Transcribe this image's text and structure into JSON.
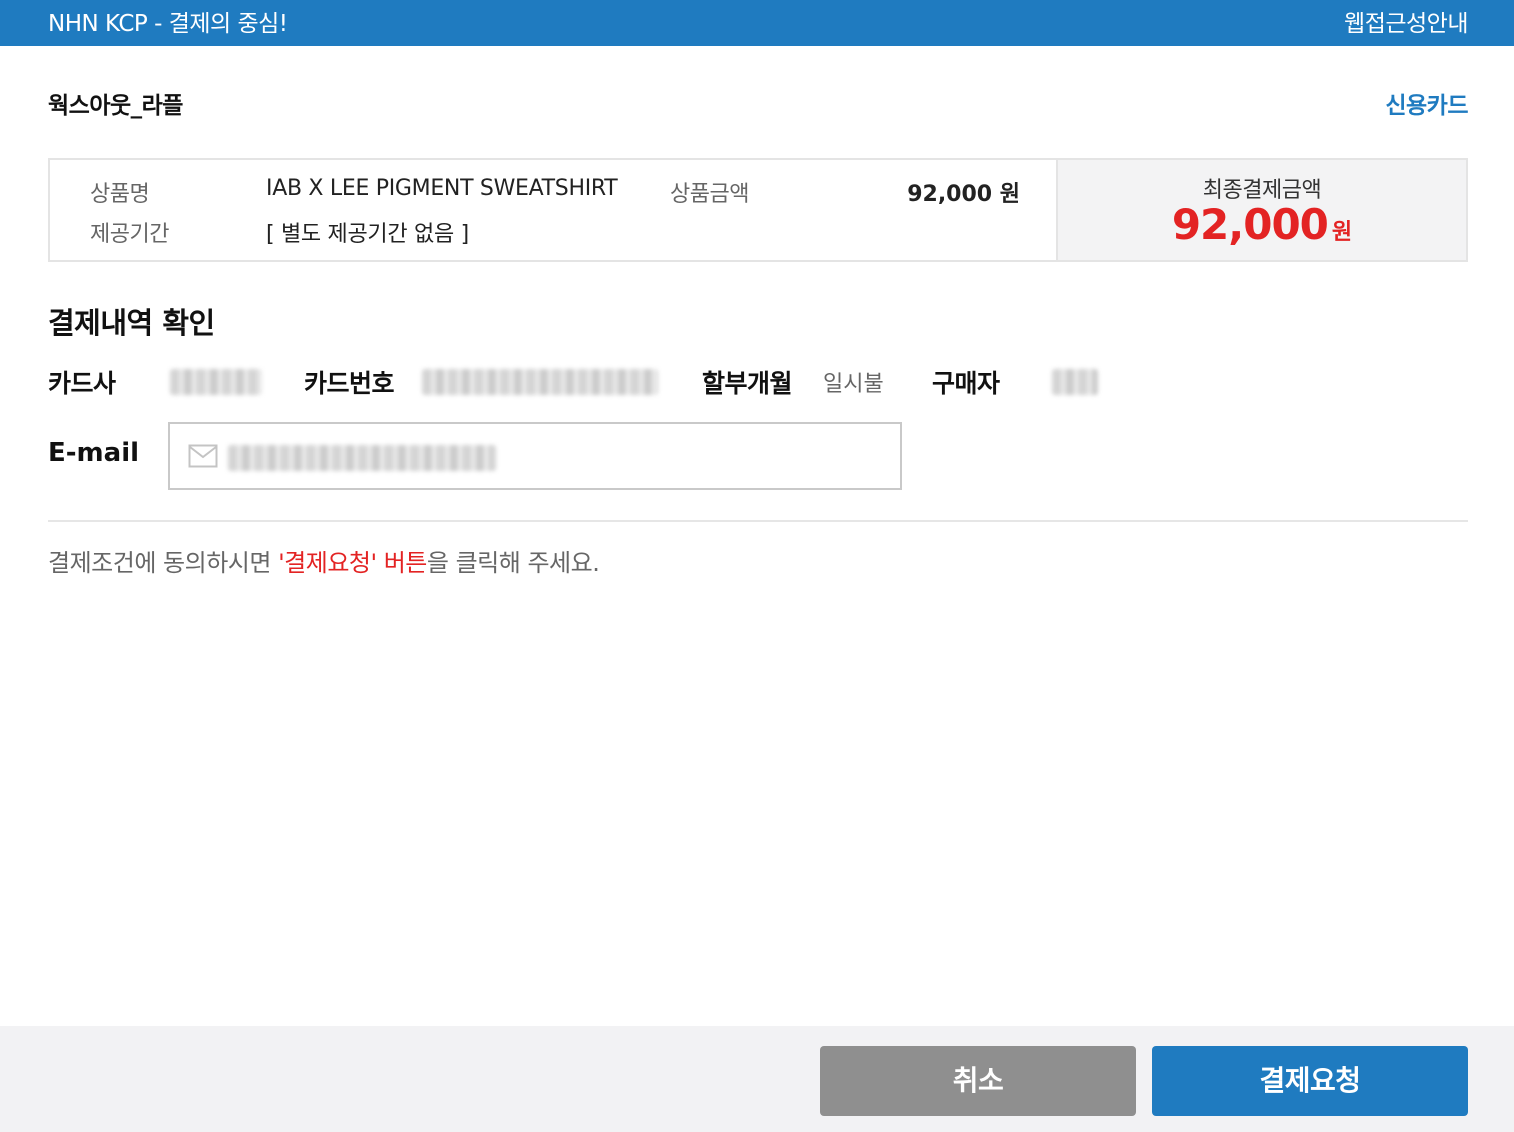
{
  "header": {
    "brand": "NHN KCP - 결제의 중심!",
    "accessibility_link": "웹접근성안내"
  },
  "merchant": {
    "name": "웍스아웃_라플",
    "payment_method": "신용카드"
  },
  "summary": {
    "product_name_label": "상품명",
    "product_name": "IAB X LEE PIGMENT SWEATSHIRT",
    "product_price_label": "상품금액",
    "product_price": "92,000 원",
    "period_label": "제공기간",
    "period": "[ 별도 제공기간 없음 ]",
    "final_label": "최종결제금액",
    "final_amount": "92,000",
    "final_unit": "원"
  },
  "details": {
    "title": "결제내역 확인",
    "card_company_label": "카드사",
    "card_number_label": "카드번호",
    "installment_label": "할부개월",
    "installment_value": "일시불",
    "buyer_label": "구매자",
    "email_label": "E-mail"
  },
  "notice": {
    "before": "결제조건에 동의하시면 ",
    "highlight": "'결제요청' 버튼",
    "after": "을 클릭해 주세요."
  },
  "buttons": {
    "cancel": "취소",
    "pay": "결제요청"
  },
  "colors": {
    "primary": "#1f7bc0",
    "accent_red": "#e32323",
    "cancel_gray": "#8f8f8f"
  }
}
